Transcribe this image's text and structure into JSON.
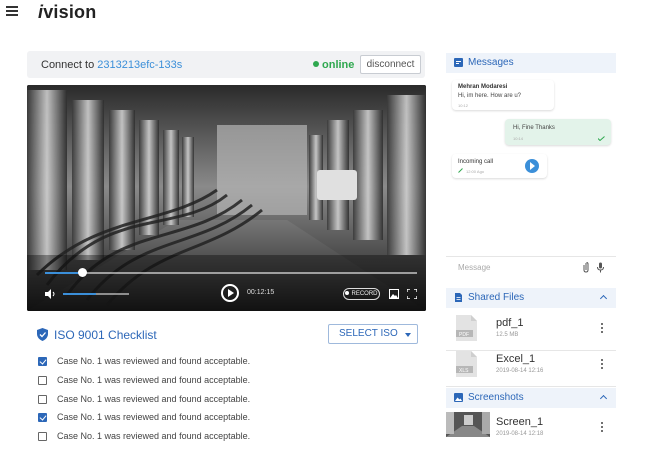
{
  "app": {
    "logo_prefix": "i",
    "logo_rest": "vision"
  },
  "connect": {
    "label": "Connect to",
    "id": "2313213efc-133s",
    "status": "online",
    "disconnect_label": "disconnect"
  },
  "player": {
    "progress": 0.1,
    "volume": 0.5,
    "time": "00:12:15",
    "record_label": "RECORD"
  },
  "checklist": {
    "title": "ISO 9001 Checklist",
    "select_label": "SELECT ISO",
    "items": [
      {
        "label": "Case No. 1 was reviewed and found acceptable.",
        "checked": true
      },
      {
        "label": "Case No. 1 was reviewed and found acceptable.",
        "checked": false
      },
      {
        "label": "Case No. 1 was reviewed and found acceptable.",
        "checked": false
      },
      {
        "label": "Case No. 1 was reviewed and found acceptable.",
        "checked": true
      },
      {
        "label": "Case No. 1 was reviewed and found acceptable.",
        "checked": false
      }
    ]
  },
  "messages": {
    "title": "Messages",
    "items": [
      {
        "name": "Mehran Modaresi",
        "text": "Hi, im here. How are u?",
        "meta": "10:12"
      },
      {
        "text": "Hi, Fine Thanks",
        "meta": "10:14"
      },
      {
        "text": "Incoming call",
        "meta": "12:00 Ago"
      }
    ],
    "input_placeholder": "Message"
  },
  "shared_files": {
    "title": "Shared Files",
    "items": [
      {
        "name": "pdf_1",
        "meta": "12.5 MB",
        "type": "PDF"
      },
      {
        "name": "Excel_1",
        "meta": "2019-08-14   12:16",
        "type": "XLS"
      }
    ]
  },
  "screenshots": {
    "title": "Screenshots",
    "items": [
      {
        "name": "Screen_1",
        "meta": "2019-08-14   12:18"
      }
    ]
  },
  "colors": {
    "accent": "#2c67b8",
    "link": "#3b8fd9",
    "online": "#2fa84f",
    "panel_bg": "#eef3fa"
  }
}
